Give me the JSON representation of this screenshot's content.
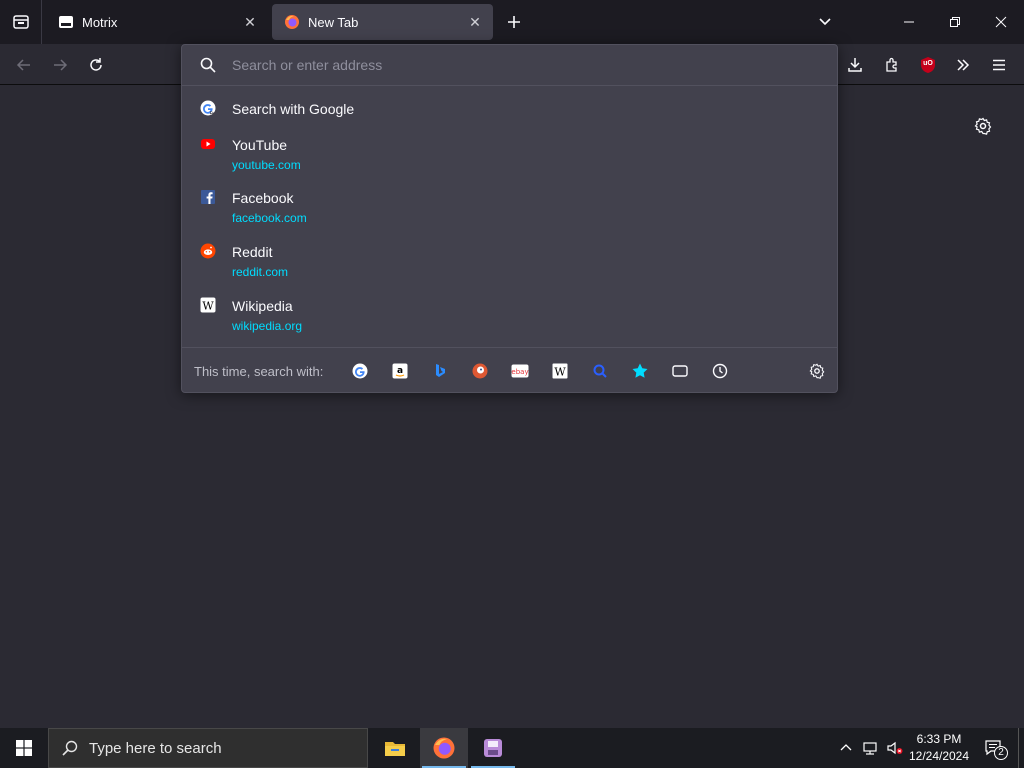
{
  "tabs": [
    {
      "label": "Motrix"
    },
    {
      "label": "New Tab"
    }
  ],
  "urlbar": {
    "placeholder": "Search or enter address",
    "results": [
      {
        "title": "Search with Google",
        "icon": "google-icon"
      },
      {
        "title": "YouTube",
        "url": "youtube.com",
        "icon": "youtube-icon"
      },
      {
        "title": "Facebook",
        "url": "facebook.com",
        "icon": "facebook-icon"
      },
      {
        "title": "Reddit",
        "url": "reddit.com",
        "icon": "reddit-icon"
      },
      {
        "title": "Wikipedia",
        "url": "wikipedia.org",
        "icon": "wikipedia-icon"
      }
    ],
    "oneoff_label": "This time, search with:",
    "engines": [
      "google",
      "amazon",
      "bing",
      "duckduckgo",
      "ebay",
      "wikipedia",
      "search",
      "bookmarks",
      "tabs",
      "history"
    ]
  },
  "extension_badge": "uO",
  "taskbar": {
    "search_placeholder": "Type here to search",
    "time": "6:33 PM",
    "date": "12/24/2024",
    "notification_count": "2"
  },
  "colors": {
    "accent": "#00ddff",
    "toolbar": "#2b2a33",
    "popup": "#42414d"
  }
}
